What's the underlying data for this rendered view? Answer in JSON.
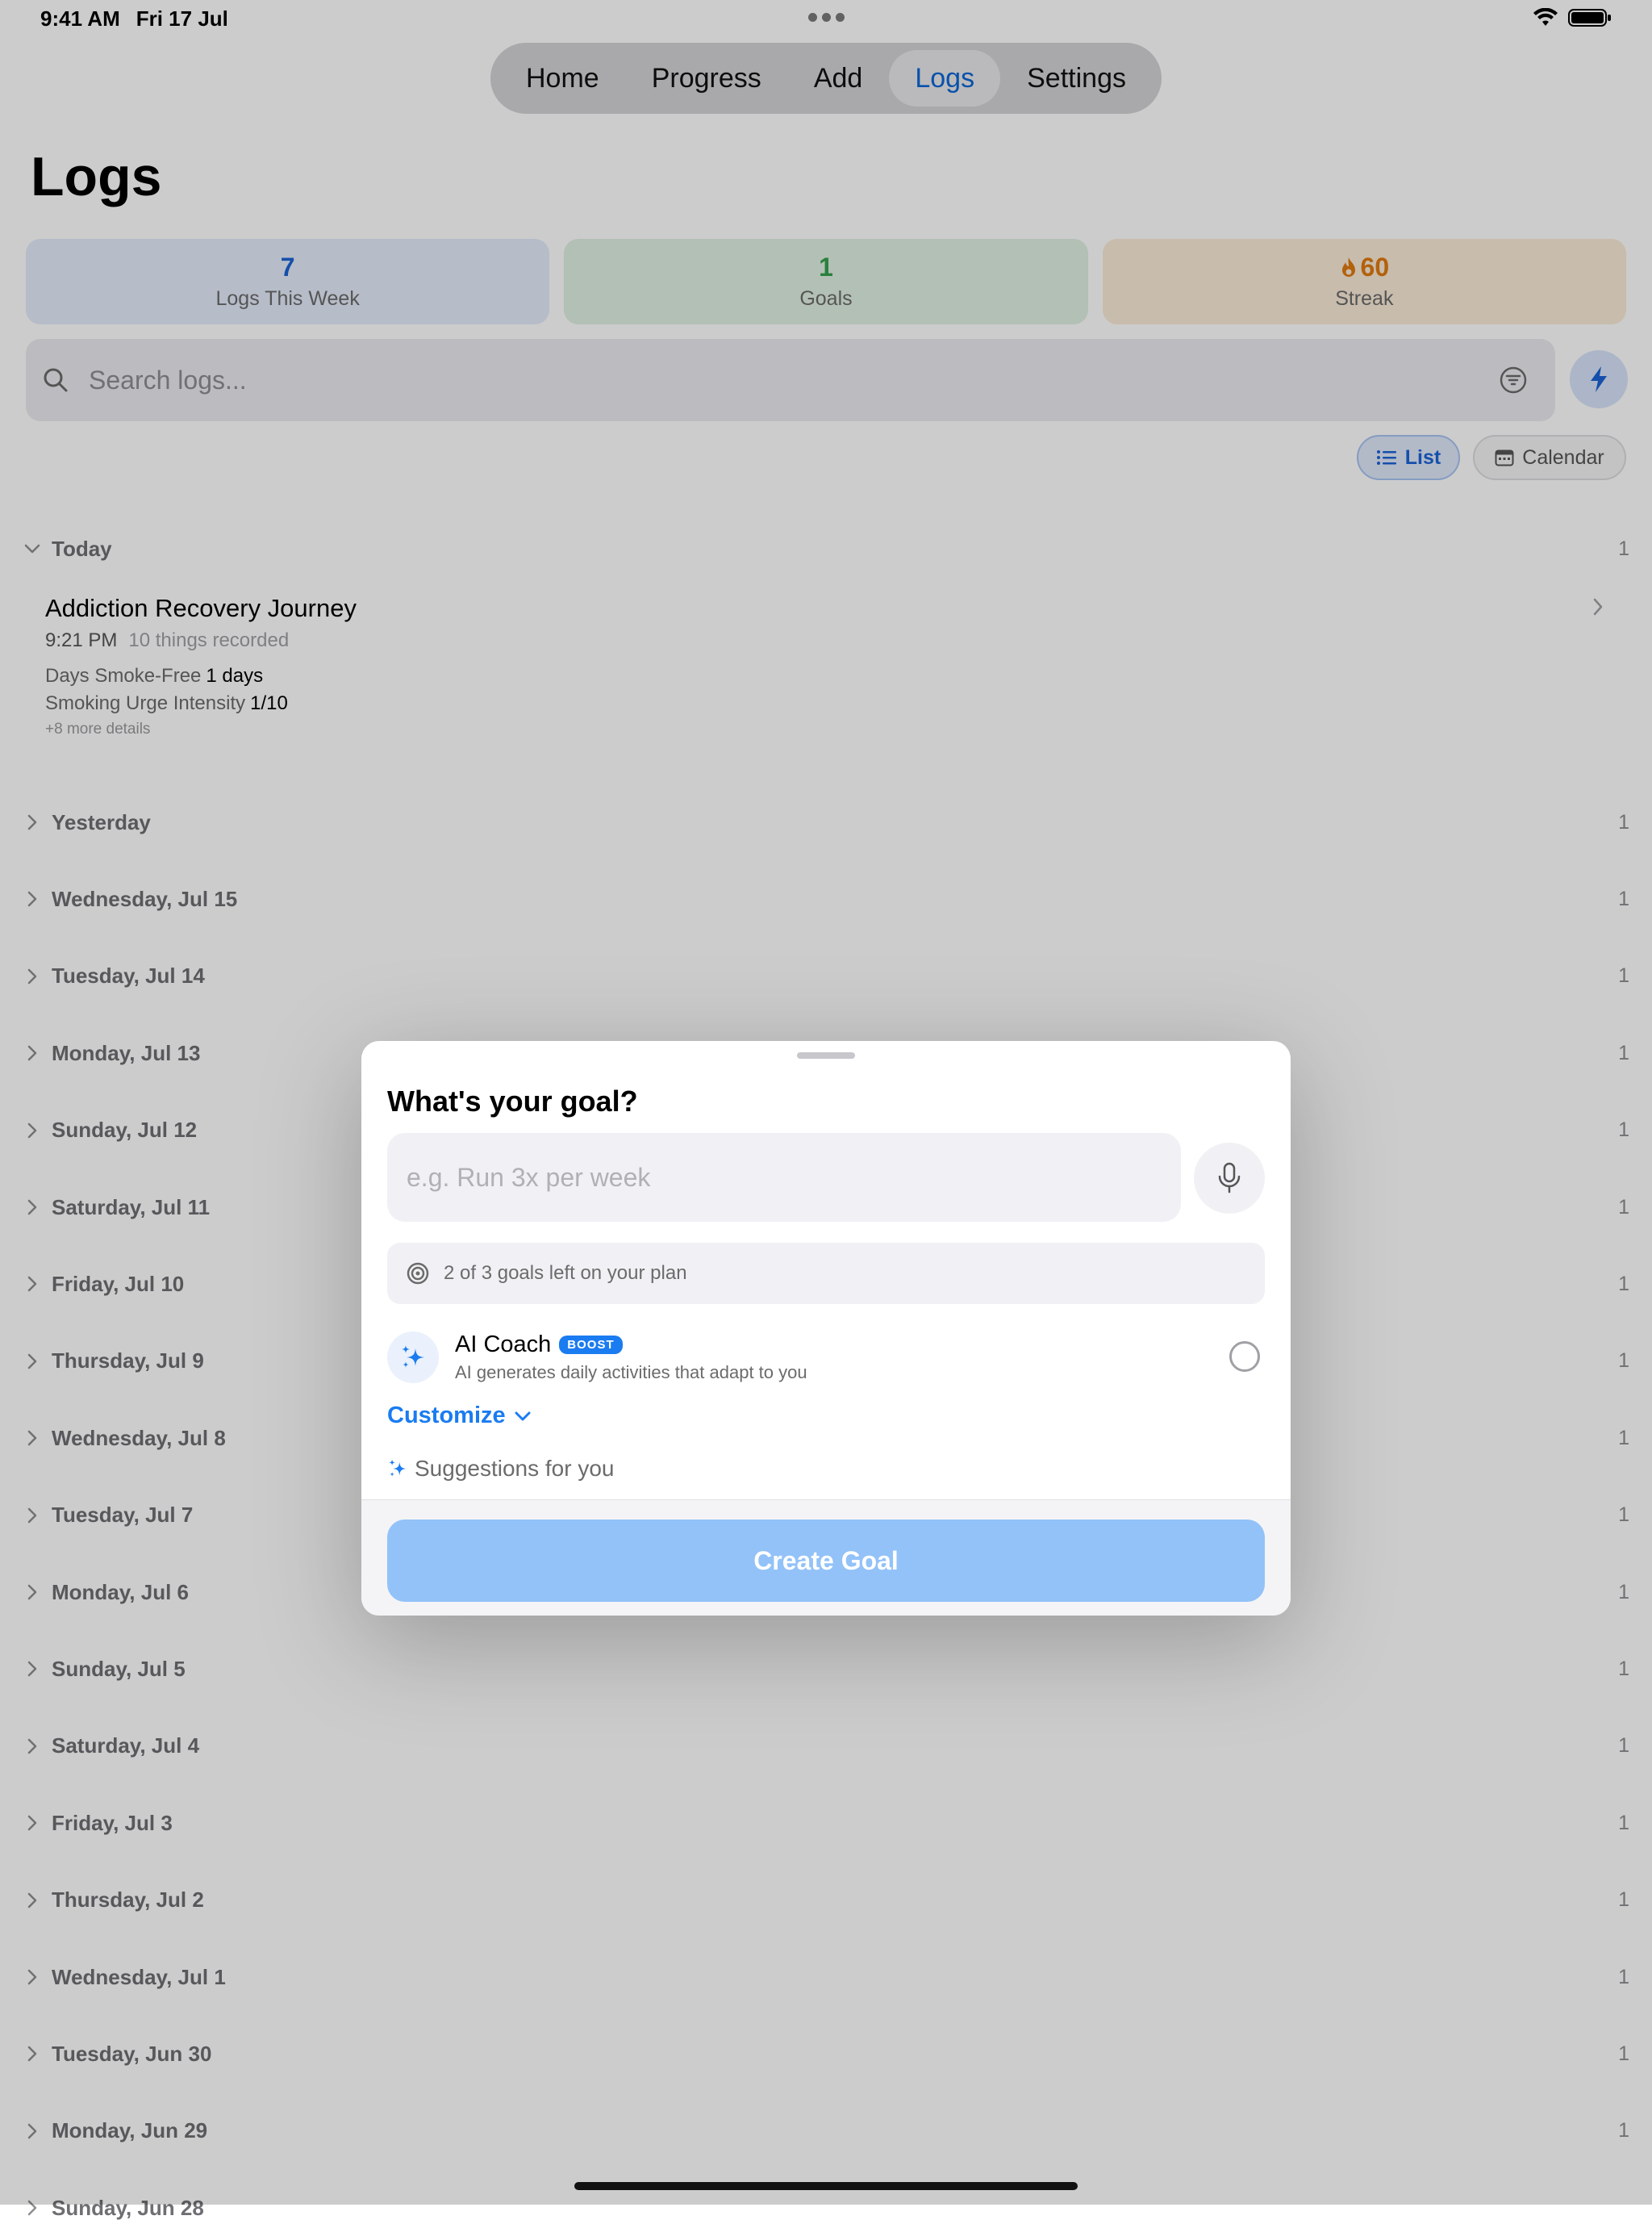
{
  "status": {
    "time": "9:41 AM",
    "date": "Fri 17 Jul"
  },
  "tabs": [
    {
      "label": "Home",
      "active": false
    },
    {
      "label": "Progress",
      "active": false
    },
    {
      "label": "Add",
      "active": false
    },
    {
      "label": "Logs",
      "active": true
    },
    {
      "label": "Settings",
      "active": false
    }
  ],
  "page": {
    "title": "Logs"
  },
  "stats": [
    {
      "value": "7",
      "label": "Logs This Week"
    },
    {
      "value": "1",
      "label": "Goals"
    },
    {
      "value": "60",
      "label": "Streak"
    }
  ],
  "search": {
    "placeholder": "Search logs..."
  },
  "view_toggle": {
    "list": "List",
    "calendar": "Calendar"
  },
  "sections": [
    {
      "label": "Today",
      "count": "1",
      "expanded": true
    },
    {
      "label": "Yesterday",
      "count": "1"
    },
    {
      "label": "Wednesday, Jul 15",
      "count": "1"
    },
    {
      "label": "Tuesday, Jul 14",
      "count": "1"
    },
    {
      "label": "Monday, Jul 13",
      "count": "1"
    },
    {
      "label": "Sunday, Jul 12",
      "count": "1"
    },
    {
      "label": "Saturday, Jul 11",
      "count": "1"
    },
    {
      "label": "Friday, Jul 10",
      "count": "1"
    },
    {
      "label": "Thursday, Jul 9",
      "count": "1"
    },
    {
      "label": "Wednesday, Jul 8",
      "count": "1"
    },
    {
      "label": "Tuesday, Jul 7",
      "count": "1"
    },
    {
      "label": "Monday, Jul 6",
      "count": "1"
    },
    {
      "label": "Sunday, Jul 5",
      "count": "1"
    },
    {
      "label": "Saturday, Jul 4",
      "count": "1"
    },
    {
      "label": "Friday, Jul 3",
      "count": "1"
    },
    {
      "label": "Thursday, Jul 2",
      "count": "1"
    },
    {
      "label": "Wednesday, Jul 1",
      "count": "1"
    },
    {
      "label": "Tuesday, Jun 30",
      "count": "1"
    },
    {
      "label": "Monday, Jun 29",
      "count": "1"
    },
    {
      "label": "Sunday, Jun 28",
      "count": ""
    }
  ],
  "entry": {
    "title": "Addiction Recovery Journey",
    "time": "9:21 PM",
    "recorded": "10 things recorded",
    "fields": [
      {
        "label": "Days Smoke-Free",
        "value": "1 days"
      },
      {
        "label": "Smoking Urge Intensity",
        "value": "1/10"
      }
    ],
    "more": "+8 more details"
  },
  "modal": {
    "title": "What's your goal?",
    "input_placeholder": "e.g. Run 3x per week",
    "plan_note": "2 of 3 goals left on your plan",
    "coach_title": "AI Coach",
    "coach_badge": "BOOST",
    "coach_subtitle": "AI generates daily activities that adapt to you",
    "customize": "Customize",
    "suggestions": "Suggestions for you",
    "create_button": "Create Goal"
  },
  "colors": {
    "accent": "#1a7cf0",
    "active_tab": "#0a66d6",
    "create_button": "#92c2f8",
    "logs_stat": "#1b63d6",
    "goals_stat": "#35a14d",
    "streak_stat": "#e07a10"
  }
}
